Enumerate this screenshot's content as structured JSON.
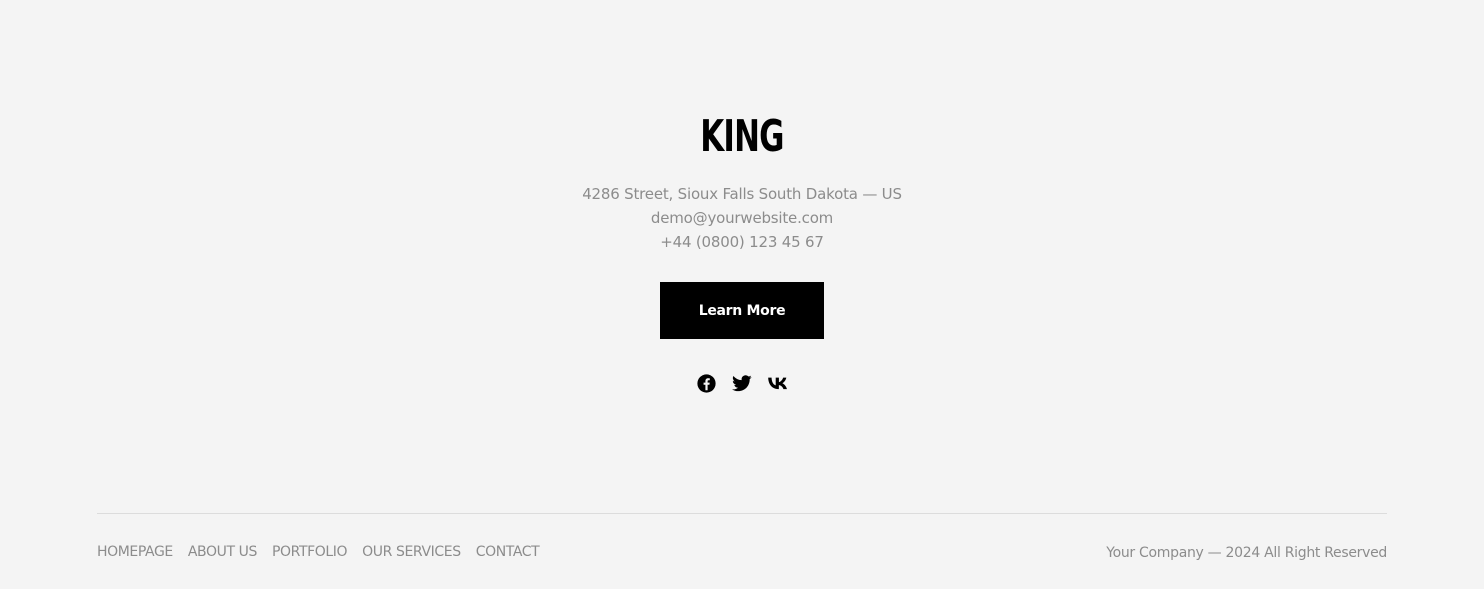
{
  "brand": {
    "name": "KING"
  },
  "contact": {
    "address": "4286 Street, Sioux Falls South Dakota — US",
    "email": "demo@yourwebsite.com",
    "phone": "+44 (0800) 123 45 67"
  },
  "cta": {
    "label": "Learn More"
  },
  "socials": [
    {
      "icon": "facebook-icon"
    },
    {
      "icon": "twitter-icon"
    },
    {
      "icon": "vk-icon"
    }
  ],
  "nav": {
    "items": [
      {
        "label": "HOMEPAGE"
      },
      {
        "label": "ABOUT US"
      },
      {
        "label": "PORTFOLIO"
      },
      {
        "label": "OUR SERVICES"
      },
      {
        "label": "CONTACT"
      }
    ]
  },
  "copyright": {
    "text": "Your Company — 2024 All Right Reserved"
  },
  "colors": {
    "background": "#f4f4f4",
    "text_muted": "#8c8c8c",
    "primary": "#000000",
    "button_text": "#ffffff",
    "divider": "#dcdcdc"
  }
}
